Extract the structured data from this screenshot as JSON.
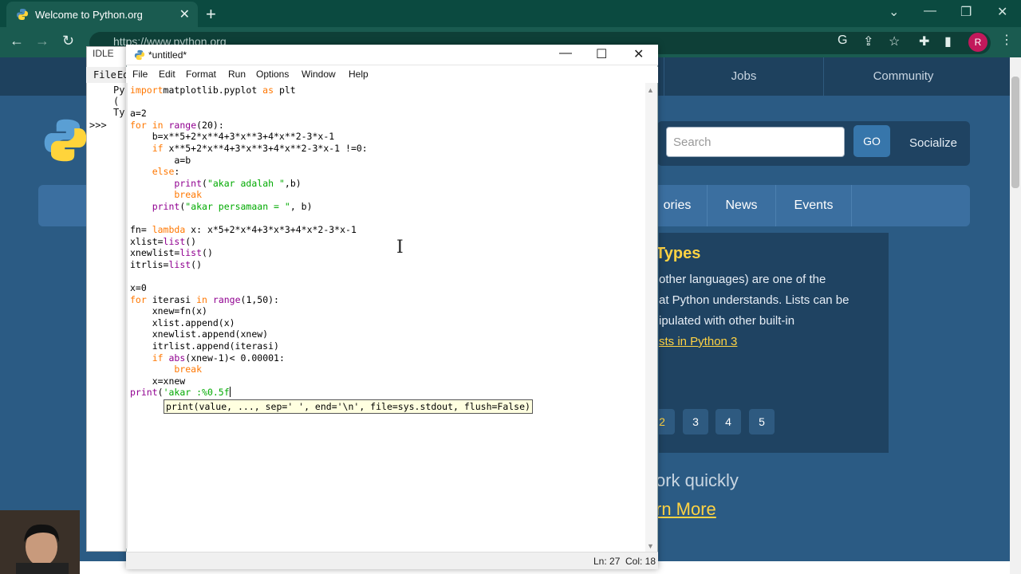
{
  "browser": {
    "tab_title": "Welcome to Python.org",
    "url": "https://www.python.org",
    "profile_initial": "R"
  },
  "site": {
    "top_nav": [
      "Jobs",
      "Community"
    ],
    "search_placeholder": "Search",
    "go_label": "GO",
    "socialize_label": "Socialize",
    "main_nav": [
      "ories",
      "News",
      "Events"
    ],
    "section_heading": "Types",
    "body_lines": [
      " other languages) are one of the",
      "at Python understands. Lists can be",
      "ipulated with other built-in"
    ],
    "link_text": "sts in Python 3",
    "pages": [
      "2",
      "3",
      "4",
      "5"
    ],
    "work_heading": "ork quickly",
    "learn_more": "rn More"
  },
  "shell": {
    "title": "IDLE",
    "menu": [
      "File",
      "Ed"
    ],
    "lines": [
      "Py",
      " (",
      "Ty"
    ],
    "prompt": ">>>"
  },
  "editor": {
    "title": "*untitled*",
    "menus": [
      "File",
      "Edit",
      "Format",
      "Run",
      "Options",
      "Window",
      "Help"
    ],
    "calltip": "print(value, ..., sep=' ', end='\\n', file=sys.stdout, flush=False)",
    "status_line": "Ln: 27",
    "status_col": "Col: 18"
  },
  "code_lines": [
    [
      [
        "kw",
        "import"
      ],
      [
        "",
        "matplotlib.pyplot "
      ],
      [
        "kw",
        "as"
      ],
      [
        "",
        " plt"
      ]
    ],
    [],
    [
      [
        "",
        "a=2"
      ]
    ],
    [
      [
        "kw",
        "for"
      ],
      [
        "",
        ""
      ],
      [
        "kw",
        " in"
      ],
      [
        "",
        " "
      ],
      [
        "bi",
        "range"
      ],
      [
        "",
        "(20):"
      ]
    ],
    [
      [
        "",
        "    b=x**5+2*x**4+3*x**3+4*x**2-3*x-1"
      ]
    ],
    [
      [
        "kw",
        "    if"
      ],
      [
        "",
        " x**5+2*x**4+3*x**3+4*x**2-3*x-1 !=0:"
      ]
    ],
    [
      [
        "",
        "        a=b"
      ]
    ],
    [
      [
        "kw",
        "    else"
      ],
      [
        "",
        ":"
      ]
    ],
    [
      [
        "",
        "        "
      ],
      [
        "bi",
        "print"
      ],
      [
        "",
        "("
      ],
      [
        "st",
        "\"akar adalah \""
      ],
      [
        "",
        ",b)"
      ]
    ],
    [
      [
        "kw",
        "        break"
      ]
    ],
    [
      [
        "",
        "    "
      ],
      [
        "bi",
        "print"
      ],
      [
        "",
        "("
      ],
      [
        "st",
        "\"akar persamaan = \""
      ],
      [
        "",
        ", b)"
      ]
    ],
    [],
    [
      [
        "",
        "fn= "
      ],
      [
        "kw",
        "lambda"
      ],
      [
        "",
        " x: x*5+2*x*4+3*x*3+4*x*2-3*x-1"
      ]
    ],
    [
      [
        "",
        "xlist="
      ],
      [
        "bi",
        "list"
      ],
      [
        "",
        "()"
      ]
    ],
    [
      [
        "",
        "xnewlist="
      ],
      [
        "bi",
        "list"
      ],
      [
        "",
        "()"
      ]
    ],
    [
      [
        "",
        "itrlis="
      ],
      [
        "bi",
        "list"
      ],
      [
        "",
        "()"
      ]
    ],
    [],
    [
      [
        "",
        "x=0"
      ]
    ],
    [
      [
        "kw",
        "for"
      ],
      [
        "",
        " iterasi "
      ],
      [
        "kw",
        "in"
      ],
      [
        "",
        " "
      ],
      [
        "bi",
        "range"
      ],
      [
        "",
        "(1,50):"
      ]
    ],
    [
      [
        "",
        "    xnew=fn(x)"
      ]
    ],
    [
      [
        "",
        "    xlist.append(x)"
      ]
    ],
    [
      [
        "",
        "    xnewlist.append(xnew)"
      ]
    ],
    [
      [
        "",
        "    itrlist.append(iterasi)"
      ]
    ],
    [
      [
        "kw",
        "    if"
      ],
      [
        "",
        " "
      ],
      [
        "bi",
        "abs"
      ],
      [
        "",
        "(xnew-1)< 0.00001:"
      ]
    ],
    [
      [
        "kw",
        "        break"
      ]
    ],
    [
      [
        "",
        "    x=xnew"
      ]
    ],
    [
      [
        "bi",
        "print"
      ],
      [
        "",
        "("
      ],
      [
        "st",
        "'akar :%0.5f"
      ]
    ]
  ]
}
